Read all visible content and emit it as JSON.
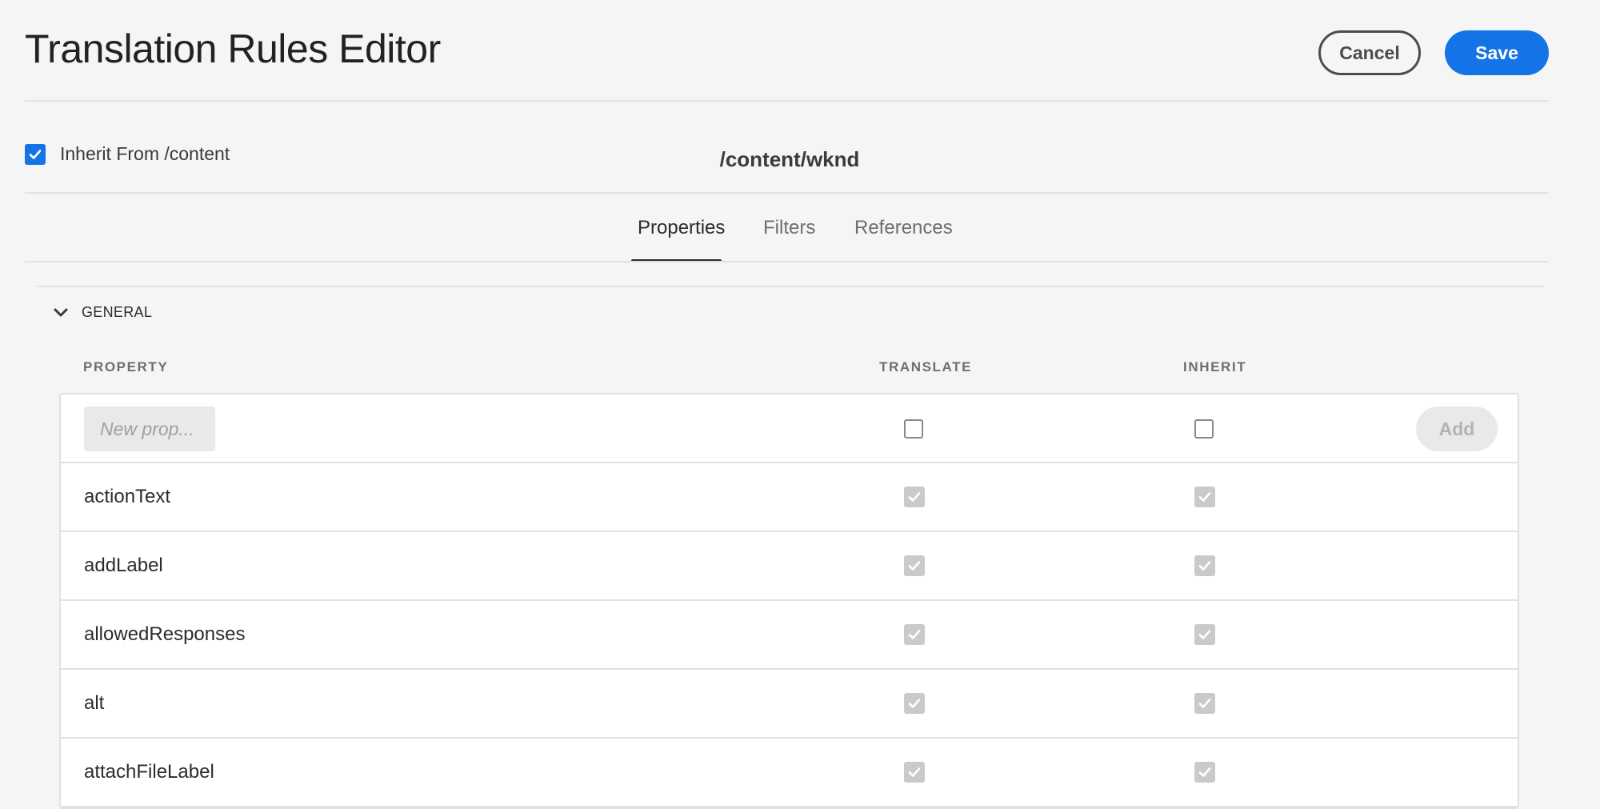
{
  "header": {
    "title": "Translation Rules Editor",
    "cancel_label": "Cancel",
    "save_label": "Save"
  },
  "inherit": {
    "checked": true,
    "label": "Inherit From /content"
  },
  "path": "/content/wknd",
  "tabs": [
    {
      "label": "Properties",
      "active": true
    },
    {
      "label": "Filters",
      "active": false
    },
    {
      "label": "References",
      "active": false
    }
  ],
  "section": {
    "label": "GENERAL",
    "expanded": true
  },
  "columns": {
    "property": "PROPERTY",
    "translate": "TRANSLATE",
    "inherit": "INHERIT"
  },
  "new_row": {
    "placeholder": "New prop...",
    "add_label": "Add"
  },
  "rows": [
    {
      "property": "actionText",
      "translate": true,
      "inherit": true
    },
    {
      "property": "addLabel",
      "translate": true,
      "inherit": true
    },
    {
      "property": "allowedResponses",
      "translate": true,
      "inherit": true
    },
    {
      "property": "alt",
      "translate": true,
      "inherit": true
    },
    {
      "property": "attachFileLabel",
      "translate": true,
      "inherit": true
    }
  ],
  "colors": {
    "accent": "#1473e6",
    "background": "#f5f5f5",
    "disabled_check": "#cacaca"
  }
}
